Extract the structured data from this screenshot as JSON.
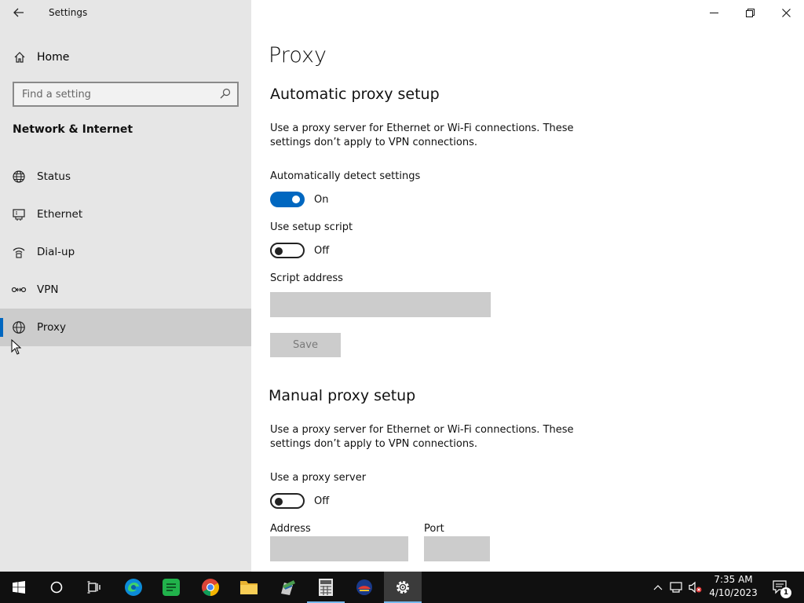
{
  "window": {
    "title": "Settings",
    "controls": [
      "minimize-icon",
      "restore-icon",
      "close-icon"
    ]
  },
  "sidebar": {
    "home_label": "Home",
    "search": {
      "placeholder": "Find a setting",
      "value": ""
    },
    "section_title": "Network & Internet",
    "items": [
      {
        "label": "Status",
        "icon": "globe-status-icon",
        "selected": false
      },
      {
        "label": "Ethernet",
        "icon": "ethernet-icon",
        "selected": false
      },
      {
        "label": "Dial-up",
        "icon": "dialup-icon",
        "selected": false
      },
      {
        "label": "VPN",
        "icon": "vpn-icon",
        "selected": false
      },
      {
        "label": "Proxy",
        "icon": "globe-icon",
        "selected": true
      }
    ]
  },
  "main": {
    "page_title": "Proxy",
    "automatic": {
      "heading": "Automatic proxy setup",
      "description": "Use a proxy server for Ethernet or Wi-Fi connections. These settings don’t apply to VPN connections.",
      "auto_detect_label": "Automatically detect settings",
      "auto_detect_state": "On",
      "setup_script_label": "Use setup script",
      "setup_script_state": "Off",
      "script_address_label": "Script address",
      "script_address_value": "",
      "save_label": "Save"
    },
    "manual": {
      "heading": "Manual proxy setup",
      "description": "Use a proxy server for Ethernet or Wi-Fi connections. These settings don’t apply to VPN connections.",
      "use_proxy_label": "Use a proxy server",
      "use_proxy_state": "Off",
      "address_label": "Address",
      "address_value": "",
      "port_label": "Port",
      "port_value": ""
    }
  },
  "taskbar": {
    "apps": [
      "start-icon",
      "cortana-icon",
      "task-view-icon",
      "edge-icon",
      "spreadsheet-icon",
      "chrome-icon",
      "file-explorer-icon",
      "paint-icon",
      "calculator-icon",
      "app-icon",
      "settings-icon"
    ],
    "time": "7:35 AM",
    "date": "4/10/2023",
    "notification_count": "1"
  },
  "colors": {
    "accent": "#0067c0",
    "sidebar_bg": "#e6e6e6",
    "selected_bg": "#cccccc",
    "taskbar_bg": "#101010"
  }
}
